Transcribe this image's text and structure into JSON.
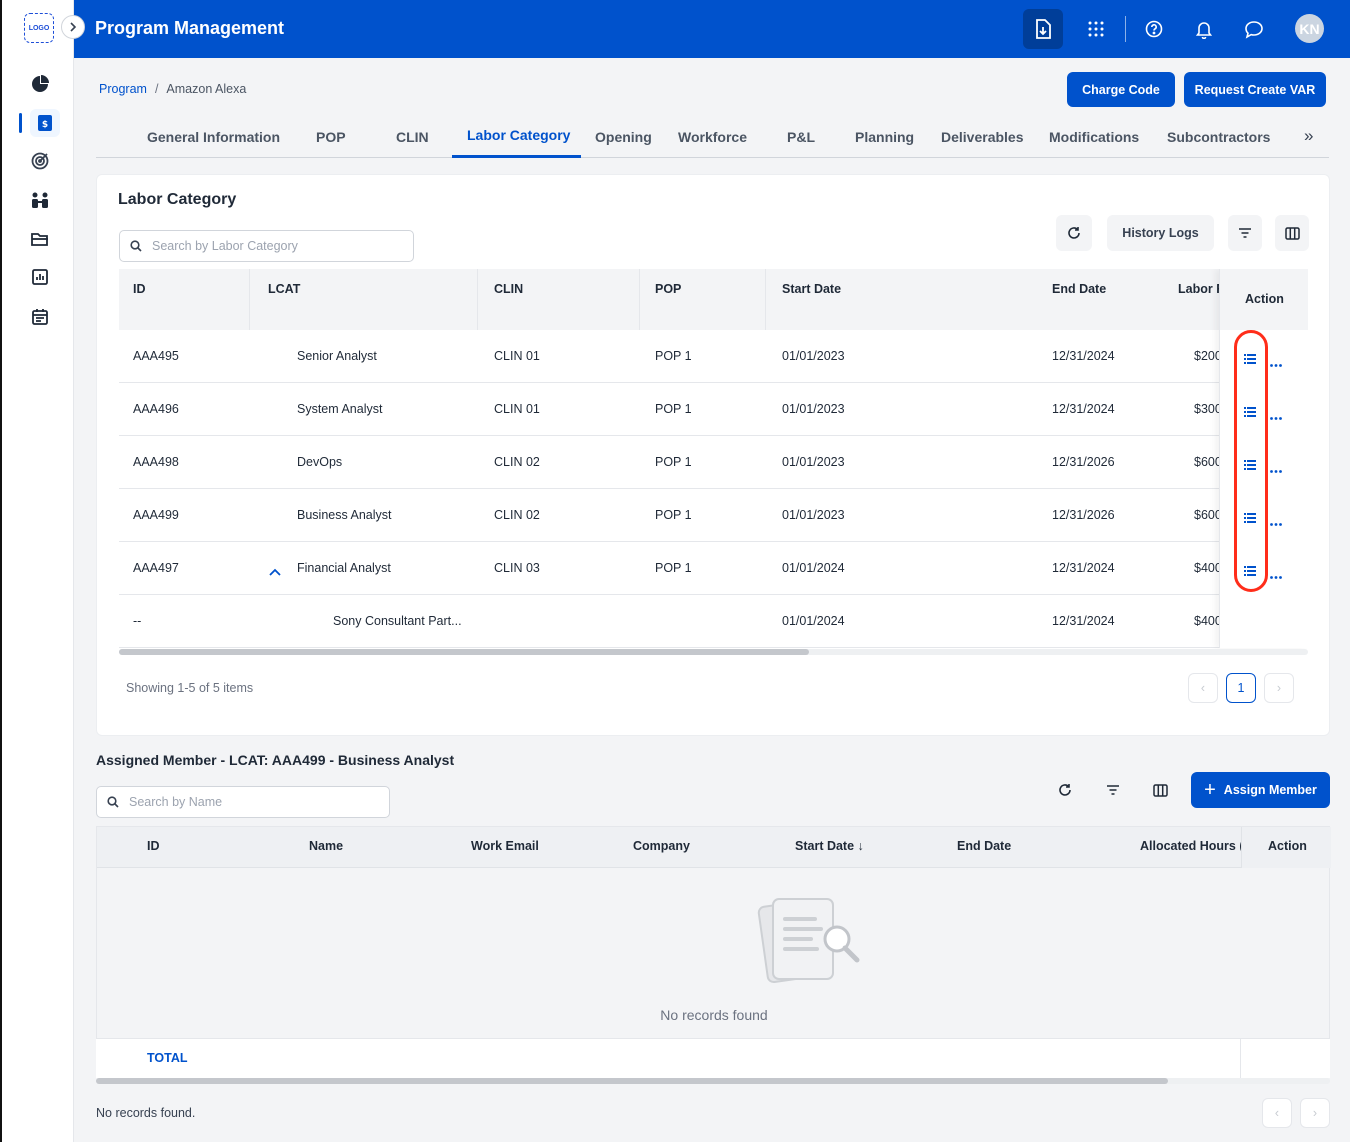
{
  "app": {
    "logo_text": "LOGO",
    "title": "Program Management",
    "user_initials": "KN"
  },
  "colors": {
    "brand": "#0052cc",
    "highlight": "#ff2d1a"
  },
  "sidebar": {
    "icons": [
      "pie-chart-icon",
      "program-icon",
      "target-icon",
      "team-icon",
      "folder-icon",
      "report-icon",
      "calendar-icon"
    ]
  },
  "topbar": {
    "icons": [
      "download-icon",
      "apps-grid-icon",
      "help-icon",
      "bell-icon",
      "chat-icon"
    ]
  },
  "breadcrumb": {
    "root": "Program",
    "separator": "/",
    "current": "Amazon Alexa"
  },
  "header_buttons": {
    "charge_code": "Charge Code",
    "request_var": "Request Create VAR"
  },
  "tabs": [
    "General Information",
    "POP",
    "CLIN",
    "Labor Category",
    "Opening",
    "Workforce",
    "P&L",
    "Planning",
    "Deliverables",
    "Modifications",
    "Subcontractors"
  ],
  "active_tab": "Labor Category",
  "labor_category": {
    "title": "Labor Category",
    "search_placeholder": "Search by Labor Category",
    "history_logs": "History Logs",
    "columns": [
      "ID",
      "LCAT",
      "CLIN",
      "POP",
      "Start Date",
      "End Date",
      "Labor R",
      "Action"
    ],
    "rows": [
      {
        "id": "AAA495",
        "lcat": "Senior Analyst",
        "clin": "CLIN 01",
        "pop": "POP 1",
        "start": "01/01/2023",
        "end": "12/31/2024",
        "rate": "$200"
      },
      {
        "id": "AAA496",
        "lcat": "System Analyst",
        "clin": "CLIN 01",
        "pop": "POP 1",
        "start": "01/01/2023",
        "end": "12/31/2024",
        "rate": "$300"
      },
      {
        "id": "AAA498",
        "lcat": "DevOps",
        "clin": "CLIN 02",
        "pop": "POP 1",
        "start": "01/01/2023",
        "end": "12/31/2026",
        "rate": "$600"
      },
      {
        "id": "AAA499",
        "lcat": "Business Analyst",
        "clin": "CLIN 02",
        "pop": "POP 1",
        "start": "01/01/2023",
        "end": "12/31/2026",
        "rate": "$600"
      },
      {
        "id": "AAA497",
        "lcat": "Financial Analyst",
        "clin": "CLIN 03",
        "pop": "POP 1",
        "start": "01/01/2024",
        "end": "12/31/2024",
        "rate": "$400",
        "expanded": true
      }
    ],
    "sub_row": {
      "id": "--",
      "lcat": "Sony Consultant Part...",
      "start": "01/01/2024",
      "end": "12/31/2024",
      "rate": "$400"
    },
    "showing": "Showing 1-5 of 5 items",
    "page": "1"
  },
  "assigned": {
    "title": "Assigned Member - LCAT: AAA499 - Business Analyst",
    "search_placeholder": "Search by Name",
    "assign_button": "Assign Member",
    "columns": [
      "ID",
      "Name",
      "Work Email",
      "Company",
      "Start Date",
      "End Date",
      "Allocated Hours (I",
      "Action"
    ],
    "empty_text": "No records found",
    "total_label": "TOTAL",
    "footer_text": "No records found."
  }
}
